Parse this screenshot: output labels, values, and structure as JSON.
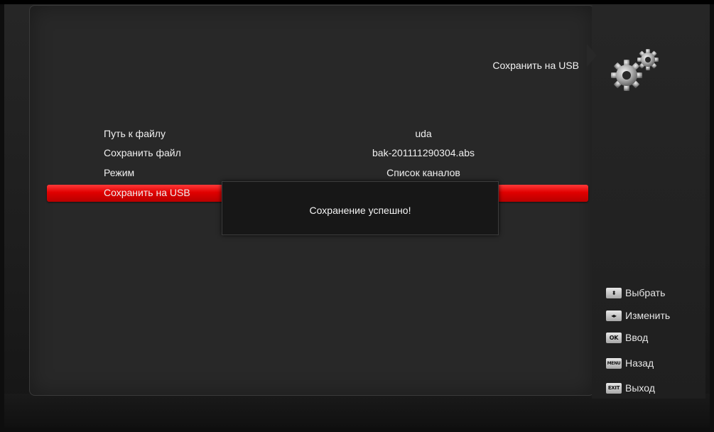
{
  "header": {
    "title": "Сохранить на USB"
  },
  "menu": {
    "items": [
      {
        "label": "Путь к файлу",
        "value": "uda",
        "selected": false
      },
      {
        "label": "Сохранить файл",
        "value": "bak-201111290304.abs",
        "selected": false
      },
      {
        "label": "Режим",
        "value": "Список каналов",
        "selected": false
      },
      {
        "label": "Сохранить на USB",
        "value": "",
        "selected": true
      }
    ]
  },
  "dialog": {
    "message": "Сохранение успешно!"
  },
  "help": {
    "items": [
      {
        "icon": "up-down-arrows-icon",
        "key": "⬍",
        "label": "Выбрать"
      },
      {
        "icon": "left-right-arrows-icon",
        "key": "◂▸",
        "label": "Изменить"
      },
      {
        "icon": "ok-key-icon",
        "key": "OK",
        "label": "Ввод"
      },
      {
        "icon": "menu-key-icon",
        "key": "MENU",
        "label": "Назад"
      },
      {
        "icon": "exit-key-icon",
        "key": "EXIT",
        "label": "Выход"
      }
    ]
  },
  "colors": {
    "selection": "#e00000",
    "panel": "#282828",
    "background": "#0e0e0e"
  },
  "icons": {
    "settings": "gears-icon"
  }
}
